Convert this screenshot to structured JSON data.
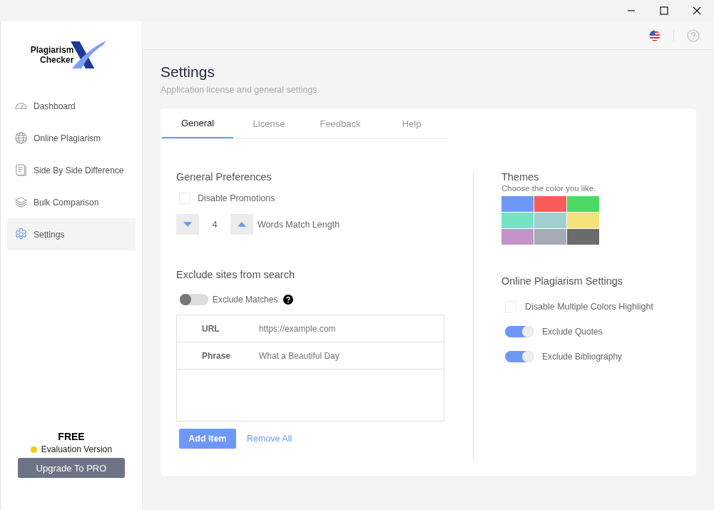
{
  "logo": {
    "line1": "Plagiarism",
    "line2": "Checker"
  },
  "sidebar": {
    "items": [
      {
        "label": "Dashboard",
        "selected": false
      },
      {
        "label": "Online Plagiarism",
        "selected": false
      },
      {
        "label": "Side By Side Difference",
        "selected": false
      },
      {
        "label": "Bulk Comparison",
        "selected": false
      },
      {
        "label": "Settings",
        "selected": true
      }
    ],
    "plan": "FREE",
    "edition": "Evaluation Version",
    "upgrade_button": "Upgrade To PRO"
  },
  "page": {
    "title": "Settings",
    "subtitle": "Application license and general settings."
  },
  "tabs": [
    {
      "label": "General",
      "selected": true
    },
    {
      "label": "License",
      "selected": false
    },
    {
      "label": "Feedback",
      "selected": false
    },
    {
      "label": "Help",
      "selected": false
    }
  ],
  "general_preferences": {
    "heading": "General Preferences",
    "disable_promotions": {
      "label": "Disable Promotions",
      "checked": false
    },
    "words_match": {
      "value": "4",
      "label": "Words Match Length"
    }
  },
  "exclude_sites": {
    "heading": "Exclude sites from search",
    "exclude_matches": {
      "label": "Exclude Matches",
      "on": false
    },
    "rows": [
      {
        "type": "URL",
        "value": "https://example.com"
      },
      {
        "type": "Phrase",
        "value": "What a Beautiful Day"
      }
    ],
    "add_button": "Add Item",
    "remove_link": "Remove All"
  },
  "themes": {
    "heading": "Themes",
    "subtitle": "Choose the color you like.",
    "swatches": [
      {
        "color": "#6e98f8"
      },
      {
        "color": "#fa5c5c"
      },
      {
        "color": "#4cd964"
      },
      {
        "color": "#73e3c3"
      },
      {
        "color": "#9fcfcf"
      },
      {
        "color": "#f5e27a"
      },
      {
        "color": "#c493c8"
      },
      {
        "color": "#a5aab5"
      },
      {
        "color": "#6b6b6b"
      }
    ]
  },
  "online_settings": {
    "heading": "Online Plagiarism Settings",
    "options": [
      {
        "kind": "checkbox",
        "label": "Disable Multiple Colors Highlight",
        "on": false
      },
      {
        "kind": "toggle",
        "label": "Exclude Quotes",
        "on": true
      },
      {
        "kind": "toggle",
        "label": "Exclude Bibliography",
        "on": true
      }
    ]
  }
}
